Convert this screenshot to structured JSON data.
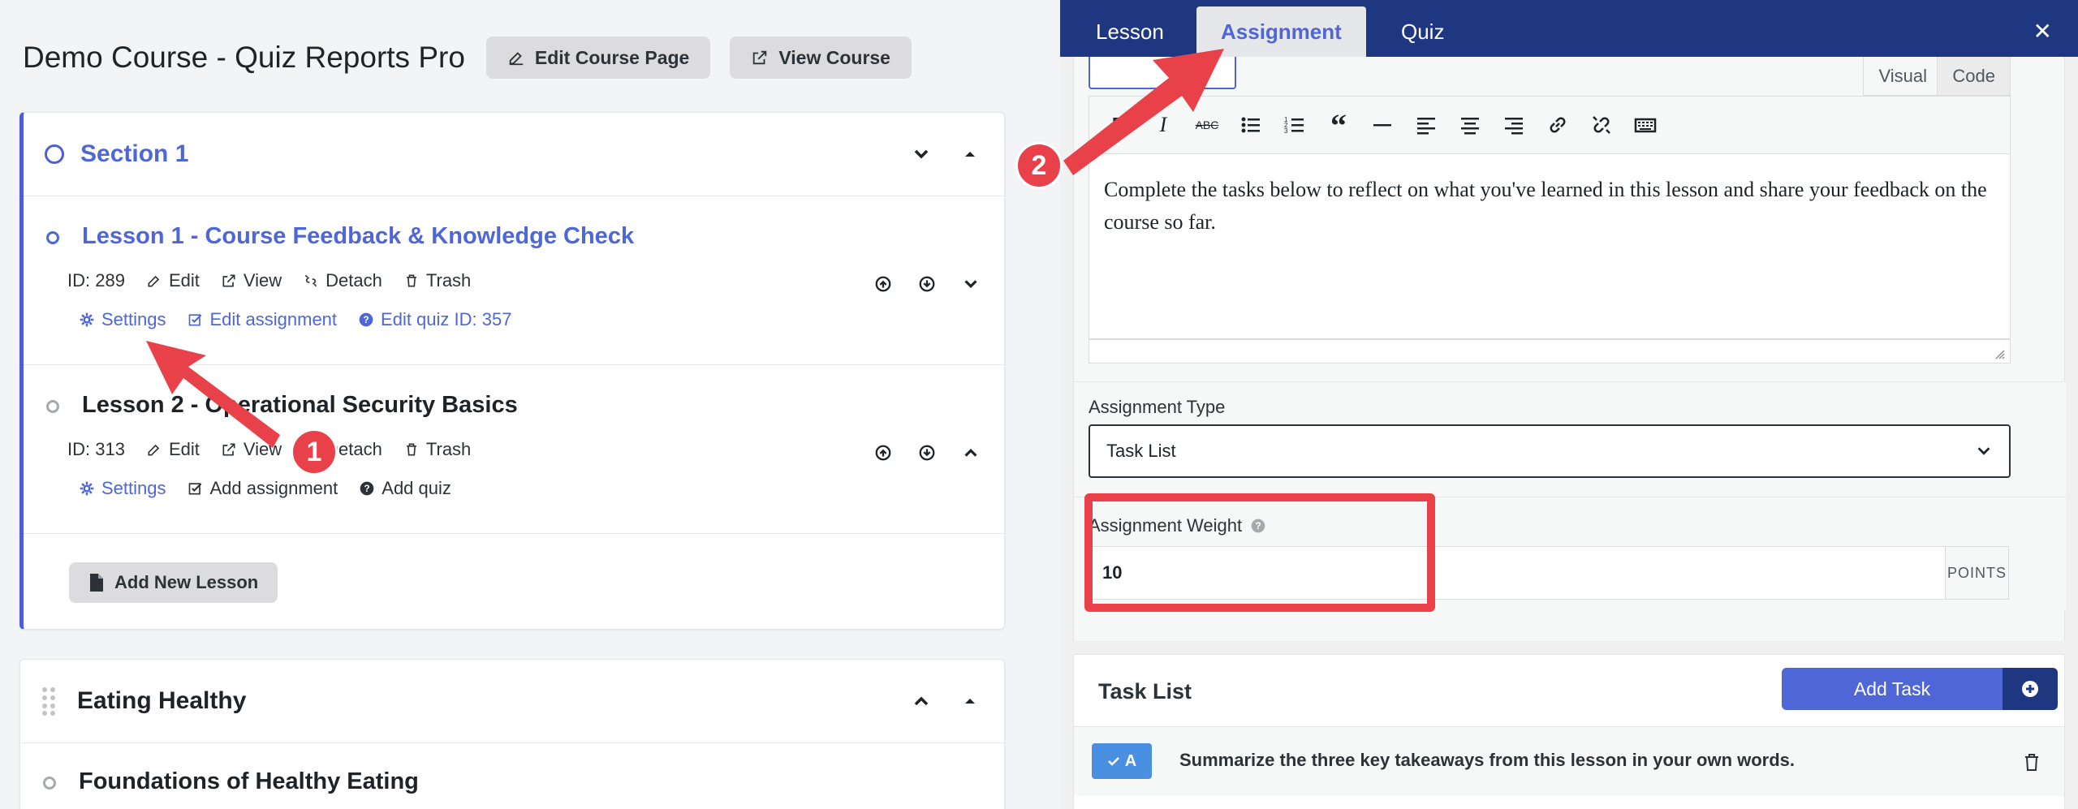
{
  "course": {
    "title": "Demo Course - Quiz Reports Pro",
    "edit_page_label": "Edit Course Page",
    "view_course_label": "View Course"
  },
  "sections": [
    {
      "title": "Section 1",
      "lessons": [
        {
          "title": "Lesson 1 - Course Feedback & Knowledge Check",
          "id_label": "ID: 289",
          "edit": "Edit",
          "view": "View",
          "detach": "Detach",
          "trash": "Trash",
          "settings": "Settings",
          "assignment": "Edit assignment",
          "quiz": "Edit quiz ID: 357"
        },
        {
          "title": "Lesson 2 - Operational Security Basics",
          "id_label": "ID: 313",
          "edit": "Edit",
          "view": "View",
          "detach": "Detach",
          "trash": "Trash",
          "settings": "Settings",
          "assignment": "Add assignment",
          "quiz": "Add quiz"
        }
      ],
      "add_lesson_label": "Add New Lesson"
    },
    {
      "title": "Eating Healthy",
      "lessons": [
        {
          "title": "Foundations of Healthy Eating"
        }
      ]
    }
  ],
  "panel": {
    "tabs": [
      "Lesson",
      "Assignment",
      "Quiz"
    ],
    "active_tab": "Assignment",
    "close_label": "✕",
    "editor": {
      "visual_tab": "Visual",
      "code_tab": "Code",
      "content": "Complete the tasks below to reflect on what you've learned in this lesson and share your feedback on the course so far."
    },
    "assignment_type": {
      "label": "Assignment Type",
      "value": "Task List"
    },
    "assignment_weight": {
      "label": "Assignment Weight",
      "value": "10",
      "addon": "POINTS"
    },
    "task_list": {
      "title": "Task List",
      "add_label": "Add Task",
      "tasks": [
        {
          "badge": "A",
          "text": "Summarize the three key takeaways from this lesson in your own words."
        }
      ]
    }
  },
  "annotations": [
    "1",
    "2"
  ],
  "colors": {
    "accent": "#4f66d6",
    "nav": "#1f3780",
    "highlight": "#e8414a"
  }
}
